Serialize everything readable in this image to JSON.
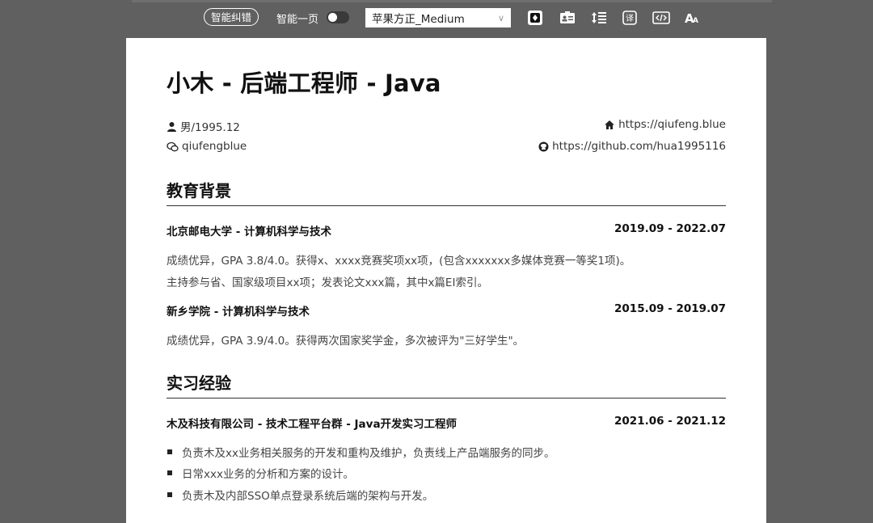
{
  "toolbar": {
    "smart_fix_label": "智能纠错",
    "one_page_label": "智能一页",
    "one_page_enabled": false,
    "font_select_value": "苹果方正_Medium",
    "icons": [
      "theme-icon",
      "id-card-icon",
      "line-spacing-icon",
      "translate-icon",
      "code-icon",
      "font-size-icon"
    ]
  },
  "resume": {
    "name": "小木 - 后端工程师 - Java",
    "gender_birth": "男/1995.12",
    "website": "https://qiufeng.blue",
    "wechat": "qiufengblue",
    "github": "https://github.com/hua1995116",
    "education": {
      "title": "教育背景",
      "entries": [
        {
          "school": "北京邮电大学 - 计算机科学与技术",
          "date": "2019.09 - 2022.07",
          "lines": [
            "成绩优异，GPA 3.8/4.0。获得x、xxxx竞赛奖项xx项，(包含xxxxxxx多媒体竞赛一等奖1项)。",
            "主持参与省、国家级项目xx项；发表论文xxx篇，其中x篇EI索引。"
          ]
        },
        {
          "school": "新乡学院 - 计算机科学与技术",
          "date": "2015.09 - 2019.07",
          "lines": [
            "成绩优异，GPA 3.9/4.0。获得两次国家奖学金，多次被评为\"三好学生\"。"
          ]
        }
      ]
    },
    "internship": {
      "title": "实习经验",
      "entries": [
        {
          "company": "木及科技有限公司 - 技术工程平台群 - Java开发实习工程师",
          "date": "2021.06 - 2021.12",
          "bullets": [
            "负责木及xx业务相关服务的开发和重构及维护，负责线上产品端服务的同步。",
            "日常xxx业务的分析和方案的设计。",
            "负责木及内部SSO单点登录系统后端的架构与开发。"
          ]
        }
      ]
    }
  }
}
